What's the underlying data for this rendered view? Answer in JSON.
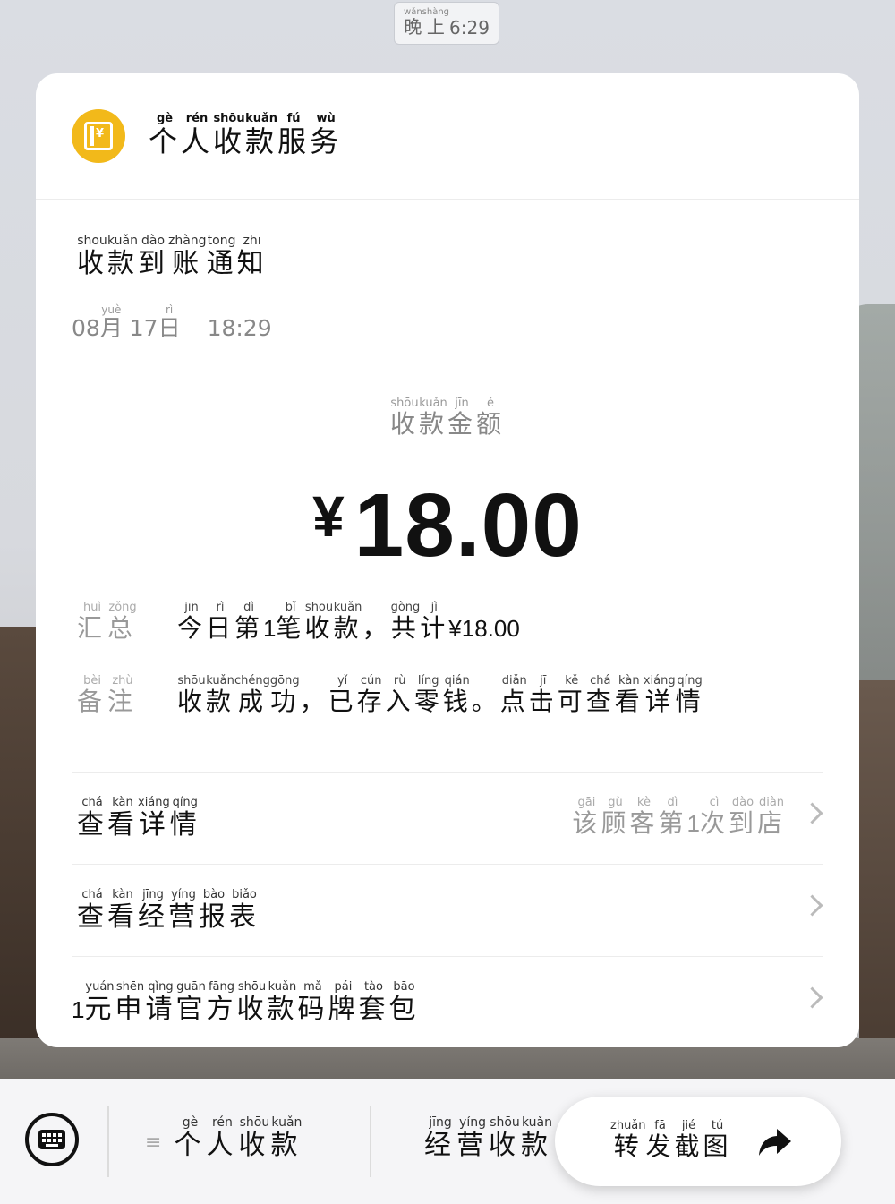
{
  "status": {
    "time_prefix": "晚上",
    "time_prefix_pinyin": [
      "wǎn",
      "shàng"
    ],
    "time": "6:29"
  },
  "header": {
    "title_chars": [
      "个",
      "人",
      "收",
      "款",
      "服",
      "务"
    ],
    "title_pinyin": [
      "gè",
      "rén",
      "shōu",
      "kuǎn",
      "fú",
      "wù"
    ],
    "logo_symbol": "¥"
  },
  "notice": {
    "title_chars": [
      "收",
      "款",
      "到",
      "账",
      "通",
      "知"
    ],
    "title_pinyin": [
      "shōu",
      "kuǎn",
      "dào",
      "zhàng",
      "tōng",
      "zhī"
    ],
    "month": "08",
    "month_char": "月",
    "month_pinyin": "yuè",
    "day": "17",
    "day_char": "日",
    "day_pinyin": "rì",
    "time": "18:29"
  },
  "amount": {
    "label_chars": [
      "收",
      "款",
      "金",
      "额"
    ],
    "label_pinyin": [
      "shōu",
      "kuǎn",
      "jīn",
      "é"
    ],
    "currency": "¥",
    "value": "18.00"
  },
  "summary": {
    "label_chars": [
      "汇",
      "总"
    ],
    "label_pinyin": [
      "huì",
      "zǒng"
    ],
    "value_parts": [
      {
        "c": "今",
        "p": "jīn"
      },
      {
        "c": "日",
        "p": "rì"
      },
      {
        "c": "第",
        "p": "dì"
      },
      {
        "n": "1"
      },
      {
        "c": "笔",
        "p": "bǐ"
      },
      {
        "c": "收",
        "p": "shōu"
      },
      {
        "c": "款",
        "p": "kuǎn"
      },
      {
        "c": "，",
        "p": ""
      },
      {
        "c": "共",
        "p": "gòng"
      },
      {
        "c": "计",
        "p": "jì"
      },
      {
        "n": "¥18.00"
      }
    ]
  },
  "remark": {
    "label_chars": [
      "备",
      "注"
    ],
    "label_pinyin": [
      "bèi",
      "zhù"
    ],
    "value_parts": [
      {
        "c": "收",
        "p": "shōu"
      },
      {
        "c": "款",
        "p": "kuǎn"
      },
      {
        "c": "成",
        "p": "chéng"
      },
      {
        "c": "功",
        "p": "gōng"
      },
      {
        "c": "，",
        "p": ""
      },
      {
        "c": "已",
        "p": "yǐ"
      },
      {
        "c": "存",
        "p": "cún"
      },
      {
        "c": "入",
        "p": "rù"
      },
      {
        "c": "零",
        "p": "líng"
      },
      {
        "c": "钱",
        "p": "qián"
      },
      {
        "c": "。",
        "p": ""
      },
      {
        "c": "点",
        "p": "diǎn"
      },
      {
        "c": "击",
        "p": "jī"
      },
      {
        "c": "可",
        "p": "kě"
      },
      {
        "c": "查",
        "p": "chá"
      },
      {
        "c": "看",
        "p": "kàn"
      },
      {
        "c": "详",
        "p": "xiáng"
      },
      {
        "c": "情",
        "p": "qíng"
      }
    ]
  },
  "menu": [
    {
      "left_parts": [
        {
          "c": "查",
          "p": "chá"
        },
        {
          "c": "看",
          "p": "kàn"
        },
        {
          "c": "详",
          "p": "xiáng"
        },
        {
          "c": "情",
          "p": "qíng"
        }
      ],
      "right_parts": [
        {
          "c": "该",
          "p": "gāi"
        },
        {
          "c": "顾",
          "p": "gù"
        },
        {
          "c": "客",
          "p": "kè"
        },
        {
          "c": "第",
          "p": "dì"
        },
        {
          "n": "1"
        },
        {
          "c": "次",
          "p": "cì"
        },
        {
          "c": "到",
          "p": "dào"
        },
        {
          "c": "店",
          "p": "diàn"
        }
      ]
    },
    {
      "left_parts": [
        {
          "c": "查",
          "p": "chá"
        },
        {
          "c": "看",
          "p": "kàn"
        },
        {
          "c": "经",
          "p": "jīng"
        },
        {
          "c": "营",
          "p": "yíng"
        },
        {
          "c": "报",
          "p": "bào"
        },
        {
          "c": "表",
          "p": "biǎo"
        }
      ],
      "right_parts": []
    },
    {
      "left_parts": [
        {
          "n": "1"
        },
        {
          "c": "元",
          "p": "yuán"
        },
        {
          "c": "申",
          "p": "shēn"
        },
        {
          "c": "请",
          "p": "qǐng"
        },
        {
          "c": "官",
          "p": "guān"
        },
        {
          "c": "方",
          "p": "fāng"
        },
        {
          "c": "收",
          "p": "shōu"
        },
        {
          "c": "款",
          "p": "kuǎn"
        },
        {
          "c": "码",
          "p": "mǎ"
        },
        {
          "c": "牌",
          "p": "pái"
        },
        {
          "c": "套",
          "p": "tào"
        },
        {
          "c": "包",
          "p": "bāo"
        }
      ],
      "right_parts": []
    }
  ],
  "bottom": {
    "tab1_parts": [
      {
        "c": "个",
        "p": "gè"
      },
      {
        "c": "人",
        "p": "rén"
      },
      {
        "c": "收",
        "p": "shōu"
      },
      {
        "c": "款",
        "p": "kuǎn"
      }
    ],
    "tab1_glyph": "≡",
    "tab2_parts": [
      {
        "c": "经",
        "p": "jīng"
      },
      {
        "c": "营",
        "p": "yíng"
      },
      {
        "c": "收",
        "p": "shōu"
      },
      {
        "c": "款",
        "p": "kuǎn"
      }
    ],
    "forward_parts": [
      {
        "c": "转",
        "p": "zhuǎn"
      },
      {
        "c": "发",
        "p": "fā"
      },
      {
        "c": "截",
        "p": "jié"
      },
      {
        "c": "图",
        "p": "tú"
      }
    ]
  },
  "colors": {
    "accent": "#f2b91a",
    "text": "#111111",
    "muted": "#999999",
    "card": "#ffffff"
  }
}
